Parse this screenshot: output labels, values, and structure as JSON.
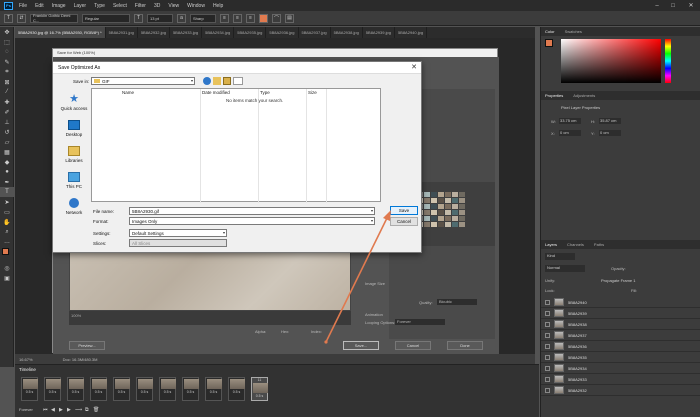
{
  "menubar": {
    "logo": "Ps",
    "items": [
      "File",
      "Edit",
      "Image",
      "Layer",
      "Type",
      "Select",
      "Filter",
      "3D",
      "View",
      "Window",
      "Help"
    ],
    "window_controls": [
      "–",
      "□",
      "✕"
    ]
  },
  "options_bar": {
    "font_family": "Franklin Gothic Demi C...",
    "font_style": "Regular",
    "font_size": "13 pt",
    "antialias": "Sharp"
  },
  "doc_tabs": [
    {
      "label": "5B8A2930.jpg @ 16.7% (5B8A2930, RGB/8*) *",
      "active": true
    },
    {
      "label": "5B8A2931.jpg",
      "active": false
    },
    {
      "label": "5B8A2932.jpg",
      "active": false
    },
    {
      "label": "5B8A2933.jpg",
      "active": false
    },
    {
      "label": "5B8A2934.jpg",
      "active": false
    },
    {
      "label": "5B8A2935.jpg",
      "active": false
    },
    {
      "label": "5B8A2936.jpg",
      "active": false
    },
    {
      "label": "5B8A2937.jpg",
      "active": false
    },
    {
      "label": "5B8A2938.jpg",
      "active": false
    },
    {
      "label": "5B8A2939.jpg",
      "active": false
    },
    {
      "label": "5B8A2940.jpg",
      "active": false
    }
  ],
  "save_for_web": {
    "title": "Save for Web (100%)",
    "preview_button": "Preview...",
    "save_button": "Save...",
    "cancel_button": "Cancel",
    "done_button": "Done",
    "zoom": "100%",
    "image_size_label": "Image Size",
    "quality_label": "Quality:",
    "quality_value": "Bicubic",
    "animation_label": "Animation",
    "looping_label": "Looping Options:",
    "looping_value": "Forever",
    "alpha_label": "Alpha:",
    "hex_label": "Hex:",
    "index_label": "Index:"
  },
  "dialog": {
    "title": "Save Optimized As",
    "save_in_label": "Save in:",
    "save_in_value": "GIF",
    "places": [
      {
        "label": "Quick access",
        "icon": "star-icon"
      },
      {
        "label": "Desktop",
        "icon": "desktop-icon"
      },
      {
        "label": "Libraries",
        "icon": "libraries-icon"
      },
      {
        "label": "This PC",
        "icon": "computer-icon"
      },
      {
        "label": "Network",
        "icon": "network-icon"
      }
    ],
    "columns": [
      "Name",
      "Date modified",
      "Type",
      "Size"
    ],
    "empty_message": "No items match your search.",
    "file_name_label": "File name:",
    "file_name_value": "5B8A2930.gif",
    "format_label": "Format:",
    "format_value": "Images Only",
    "settings_label": "Settings:",
    "settings_value": "Default Settings",
    "slices_label": "Slices:",
    "slices_value": "All Slices",
    "save_label": "Save",
    "cancel_label": "Cancel",
    "close_glyph": "✕"
  },
  "right_panel": {
    "color_tabs": [
      "Color",
      "Swatches"
    ],
    "properties_tabs": [
      "Properties",
      "Adjustments"
    ],
    "properties_title": "Pixel Layer Properties",
    "w_label": "W:",
    "w_value": "33.75 cm",
    "h_label": "H:",
    "h_value": "35.87 cm",
    "x_label": "X:",
    "x_value": "0 cm",
    "y_label": "Y:",
    "y_value": "0 cm",
    "layers_tabs": [
      "Layers",
      "Channels",
      "Paths"
    ],
    "kind_value": "Kind",
    "blend_mode": "Normal",
    "opacity_label": "Opacity:",
    "unify_label": "Unify:",
    "propagate_label": "Propagate Frame 1",
    "lock_label": "Lock:",
    "fill_label": "Fill:",
    "layers": [
      "5B8A2940",
      "5B8A2939",
      "5B8A2938",
      "5B8A2937",
      "5B8A2936",
      "5B8A2935",
      "5B8A2934",
      "5B8A2933",
      "5B8A2932"
    ]
  },
  "status_bar": {
    "zoom": "16.67%",
    "doc": "Doc: 16.3M/480.3M"
  },
  "timeline": {
    "title": "Timeline",
    "loop": "Forever",
    "frames": [
      {
        "num": "",
        "delay": "0.5 s"
      },
      {
        "num": "",
        "delay": "0.5 s"
      },
      {
        "num": "",
        "delay": "0.5 s"
      },
      {
        "num": "",
        "delay": "0.5 s"
      },
      {
        "num": "",
        "delay": "0.5 s"
      },
      {
        "num": "",
        "delay": "0.5 s"
      },
      {
        "num": "",
        "delay": "0.5 s"
      },
      {
        "num": "",
        "delay": "0.5 s"
      },
      {
        "num": "",
        "delay": "0.5 s"
      },
      {
        "num": "",
        "delay": "0.5 s"
      },
      {
        "num": "11",
        "delay": "0.5 s"
      }
    ]
  },
  "colors": {
    "arrow": "#e07a4f",
    "accent": "#0078d7",
    "fg_swatch": "#e07a4f"
  }
}
